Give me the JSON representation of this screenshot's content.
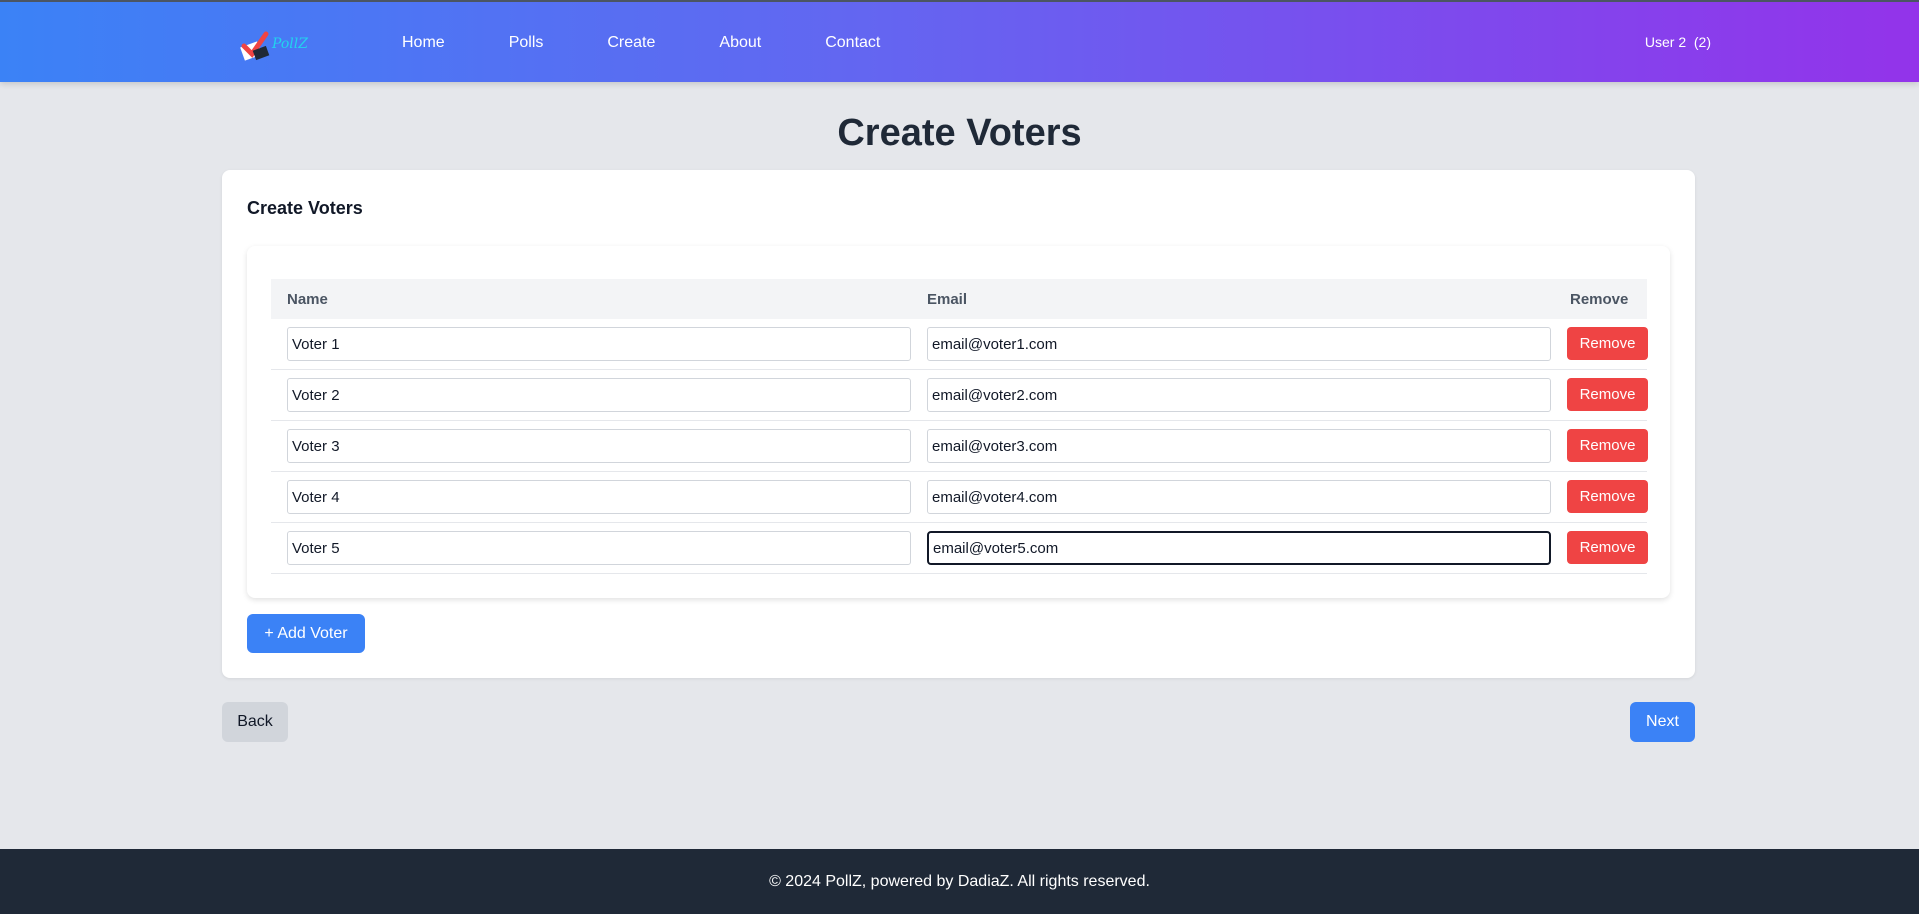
{
  "header": {
    "nav": [
      "Home",
      "Polls",
      "Create",
      "About",
      "Contact"
    ],
    "user": "User 2  (2)"
  },
  "page": {
    "title": "Create Voters",
    "card_title": "Create Voters"
  },
  "table": {
    "columns": [
      "Name",
      "Email",
      "Remove"
    ],
    "rows": [
      {
        "name": "Voter 1",
        "email": "email@voter1.com",
        "action": "Remove"
      },
      {
        "name": "Voter 2",
        "email": "email@voter2.com",
        "action": "Remove"
      },
      {
        "name": "Voter 3",
        "email": "email@voter3.com",
        "action": "Remove"
      },
      {
        "name": "Voter 4",
        "email": "email@voter4.com",
        "action": "Remove"
      },
      {
        "name": "Voter 5",
        "email": "email@voter5.com",
        "action": "Remove"
      }
    ]
  },
  "buttons": {
    "add": "+ Add Voter",
    "back": "Back",
    "next": "Next"
  },
  "footer": {
    "text": "© 2024 PollZ, powered by DadiaZ. All rights reserved."
  },
  "colors": {
    "primary": "#3b82f6",
    "danger": "#ef4444",
    "footer_bg": "#1f2937",
    "page_bg": "#e5e7eb"
  }
}
